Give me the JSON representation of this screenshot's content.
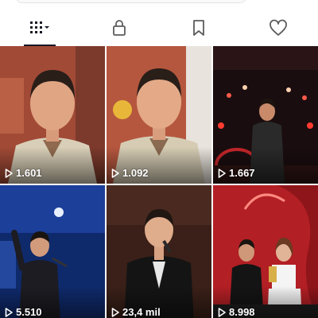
{
  "tabs": [
    {
      "name": "videos",
      "icon": "grid-dropdown-icon",
      "active": true
    },
    {
      "name": "private",
      "icon": "lock-icon",
      "active": false
    },
    {
      "name": "favorites",
      "icon": "bookmark-icon",
      "active": false
    },
    {
      "name": "liked",
      "icon": "heart-icon",
      "active": false
    }
  ],
  "videos": [
    {
      "views": "1.601"
    },
    {
      "views": "1.092"
    },
    {
      "views": "1.667"
    },
    {
      "views": "5.510"
    },
    {
      "views": "23,4 mil"
    },
    {
      "views": "8.998"
    }
  ],
  "colors": {
    "text_primary": "#161823",
    "icon_gray": "#5c5c5c"
  }
}
